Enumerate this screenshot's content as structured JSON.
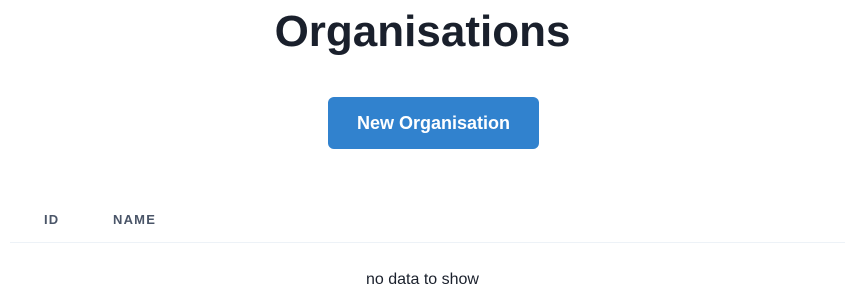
{
  "page": {
    "title": "Organisations"
  },
  "actions": {
    "new_label": "New Organisation"
  },
  "table": {
    "columns": [
      "ID",
      "NAME"
    ],
    "rows": [],
    "empty_message": "no data to show"
  },
  "colors": {
    "button_bg": "#3182ce",
    "button_text": "#ffffff",
    "title_text": "#1a202c",
    "header_text": "#4a5568",
    "divider": "#edf2f7"
  }
}
